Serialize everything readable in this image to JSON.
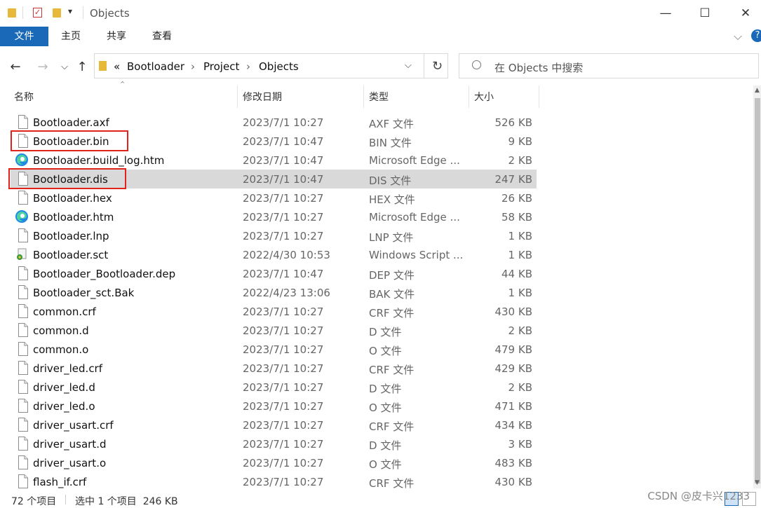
{
  "window": {
    "title": "Objects",
    "minimize": "—",
    "maximize": "☐",
    "close": "✕"
  },
  "ribbon": {
    "tabs": [
      "文件",
      "主页",
      "共享",
      "查看"
    ],
    "expand": "⌵",
    "help": "?"
  },
  "address": {
    "chevrons": "«",
    "crumbs": [
      "Bootloader",
      "Project",
      "Objects"
    ],
    "separator": "›",
    "dropdown": "⌵",
    "refresh": "↻"
  },
  "nav": {
    "back": "←",
    "forward": "→",
    "recent": "⌵",
    "up": "↑"
  },
  "search": {
    "placeholder": "在 Objects 中搜索"
  },
  "columns": {
    "name": "名称",
    "modified": "修改日期",
    "type": "类型",
    "size": "大小"
  },
  "files": [
    {
      "name": "Bootloader.axf",
      "modified": "2023/7/1 10:27",
      "type": "AXF 文件",
      "size": "526 KB",
      "icon": "file-icon"
    },
    {
      "name": "Bootloader.bin",
      "modified": "2023/7/1 10:47",
      "type": "BIN 文件",
      "size": "9 KB",
      "icon": "file-icon"
    },
    {
      "name": "Bootloader.build_log.htm",
      "modified": "2023/7/1 10:47",
      "type": "Microsoft Edge ...",
      "size": "2 KB",
      "icon": "edge-icon"
    },
    {
      "name": "Bootloader.dis",
      "modified": "2023/7/1 10:47",
      "type": "DIS 文件",
      "size": "247 KB",
      "icon": "file-icon"
    },
    {
      "name": "Bootloader.hex",
      "modified": "2023/7/1 10:27",
      "type": "HEX 文件",
      "size": "26 KB",
      "icon": "file-icon"
    },
    {
      "name": "Bootloader.htm",
      "modified": "2023/7/1 10:27",
      "type": "Microsoft Edge ...",
      "size": "58 KB",
      "icon": "edge-icon"
    },
    {
      "name": "Bootloader.lnp",
      "modified": "2023/7/1 10:27",
      "type": "LNP 文件",
      "size": "1 KB",
      "icon": "file-icon"
    },
    {
      "name": "Bootloader.sct",
      "modified": "2022/4/30 10:53",
      "type": "Windows Script ...",
      "size": "1 KB",
      "icon": "script-icon"
    },
    {
      "name": "Bootloader_Bootloader.dep",
      "modified": "2023/7/1 10:47",
      "type": "DEP 文件",
      "size": "44 KB",
      "icon": "file-icon"
    },
    {
      "name": "Bootloader_sct.Bak",
      "modified": "2022/4/23 13:06",
      "type": "BAK 文件",
      "size": "1 KB",
      "icon": "file-icon"
    },
    {
      "name": "common.crf",
      "modified": "2023/7/1 10:27",
      "type": "CRF 文件",
      "size": "430 KB",
      "icon": "file-icon"
    },
    {
      "name": "common.d",
      "modified": "2023/7/1 10:27",
      "type": "D 文件",
      "size": "2 KB",
      "icon": "file-icon"
    },
    {
      "name": "common.o",
      "modified": "2023/7/1 10:27",
      "type": "O 文件",
      "size": "479 KB",
      "icon": "file-icon"
    },
    {
      "name": "driver_led.crf",
      "modified": "2023/7/1 10:27",
      "type": "CRF 文件",
      "size": "429 KB",
      "icon": "file-icon"
    },
    {
      "name": "driver_led.d",
      "modified": "2023/7/1 10:27",
      "type": "D 文件",
      "size": "2 KB",
      "icon": "file-icon"
    },
    {
      "name": "driver_led.o",
      "modified": "2023/7/1 10:27",
      "type": "O 文件",
      "size": "471 KB",
      "icon": "file-icon"
    },
    {
      "name": "driver_usart.crf",
      "modified": "2023/7/1 10:27",
      "type": "CRF 文件",
      "size": "434 KB",
      "icon": "file-icon"
    },
    {
      "name": "driver_usart.d",
      "modified": "2023/7/1 10:27",
      "type": "D 文件",
      "size": "3 KB",
      "icon": "file-icon"
    },
    {
      "name": "driver_usart.o",
      "modified": "2023/7/1 10:27",
      "type": "O 文件",
      "size": "483 KB",
      "icon": "file-icon"
    },
    {
      "name": "flash_if.crf",
      "modified": "2023/7/1 10:27",
      "type": "CRF 文件",
      "size": "430 KB",
      "icon": "file-icon"
    }
  ],
  "selected_index": 3,
  "highlighted_indices": [
    1,
    3
  ],
  "status": {
    "count": "72 个项目",
    "selection": "选中 1 个项目  246 KB"
  },
  "watermark": "CSDN @皮卡兴1233",
  "colors": {
    "accent": "#1a69b8",
    "highlight_box": "#e0241b",
    "selection": "#d9d9d9"
  }
}
